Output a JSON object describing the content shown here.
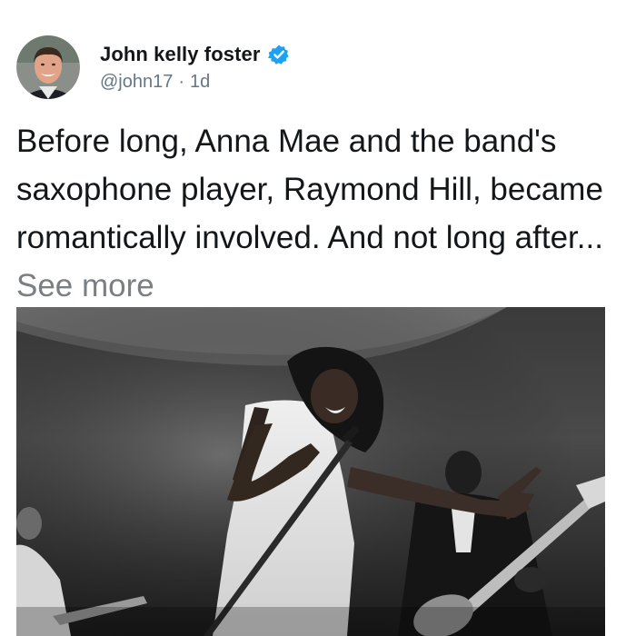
{
  "post": {
    "author": {
      "name": "John kelly foster",
      "handle": "@john17",
      "separator": "·",
      "time": "1d",
      "verified": true,
      "avatar_icon": "avatar-photo"
    },
    "text": "Before long, Anna Mae and the band's saxophone player, Raymond Hill, became romantically involved. And not long after...",
    "see_more": "See more",
    "image": {
      "kind": "black-and-white concert photo",
      "icon": "photo-image"
    }
  },
  "colors": {
    "name_text": "#14171a",
    "secondary_text": "#657786",
    "see_more": "#7a7f84",
    "verified_badge": "#1da1f2"
  }
}
